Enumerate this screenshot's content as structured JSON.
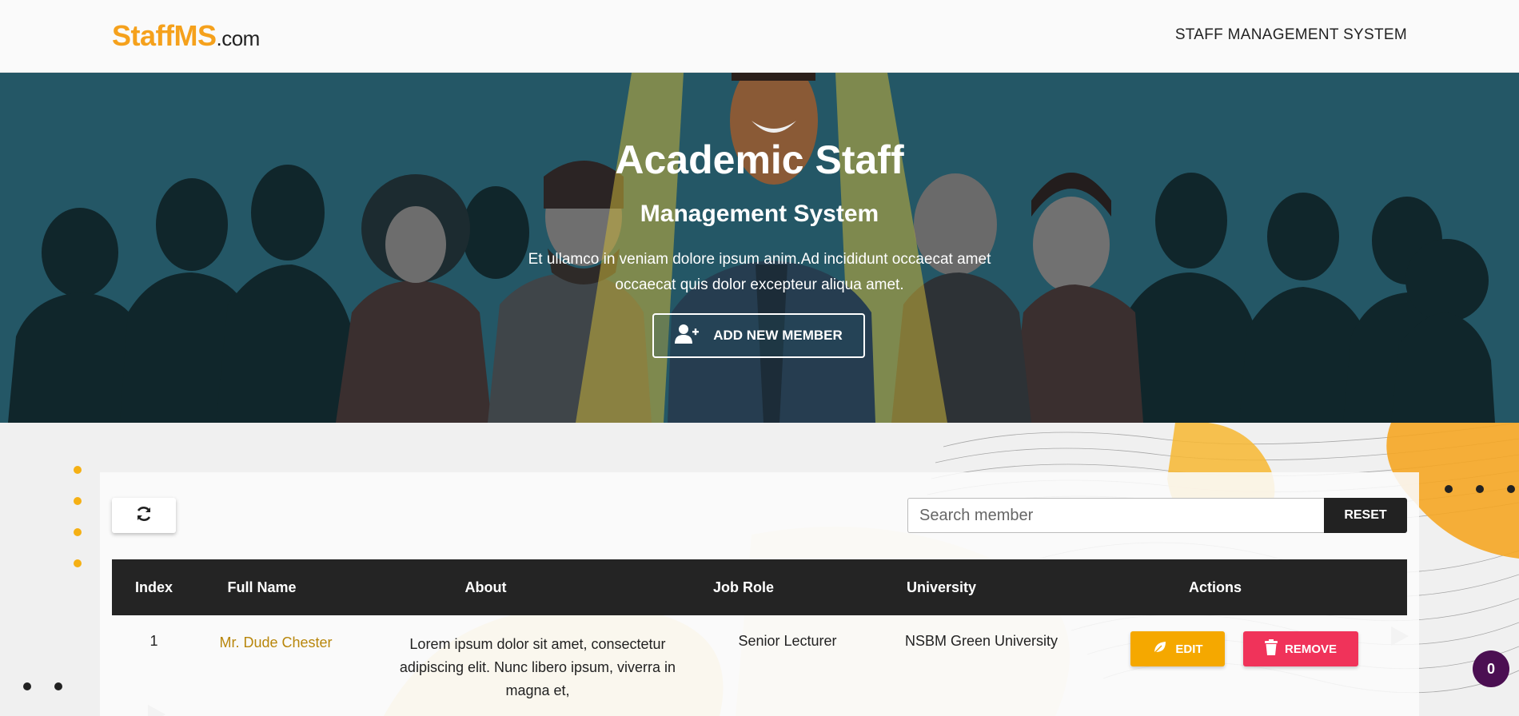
{
  "navbar": {
    "brand_name": "StaffMS",
    "brand_tld": ".com",
    "title": "STAFF MANAGEMENT SYSTEM"
  },
  "hero": {
    "title": "Academic Staff",
    "subtitle": "Management System",
    "description": "Et ullamco in veniam dolore ipsum anim.Ad incididunt occaecat amet occaecat quis dolor excepteur aliqua amet.",
    "add_button_label": "ADD NEW MEMBER",
    "add_button_icon": "user-plus-icon"
  },
  "toolbar": {
    "refresh_icon": "refresh-icon",
    "search_placeholder": "Search member",
    "reset_label": "RESET"
  },
  "table": {
    "headers": [
      "Index",
      "Full Name",
      "About",
      "Job Role",
      "University",
      "Actions"
    ],
    "rows": [
      {
        "index": "1",
        "full_name": "Mr. Dude Chester",
        "about": "Lorem ipsum dolor sit amet, consectetur adipiscing elit. Nunc libero ipsum, viverra in magna et,",
        "job_role": "Senior Lecturer",
        "university": "NSBM Green University",
        "edit_label": "EDIT",
        "remove_label": "REMOVE"
      }
    ]
  },
  "badge": {
    "count": "0"
  },
  "colors": {
    "brand": "#f5a11c",
    "hero_bg": "#245766",
    "table_header": "#242424",
    "edit": "#f5a800",
    "remove": "#f0335a",
    "badge": "#4b0f52"
  }
}
